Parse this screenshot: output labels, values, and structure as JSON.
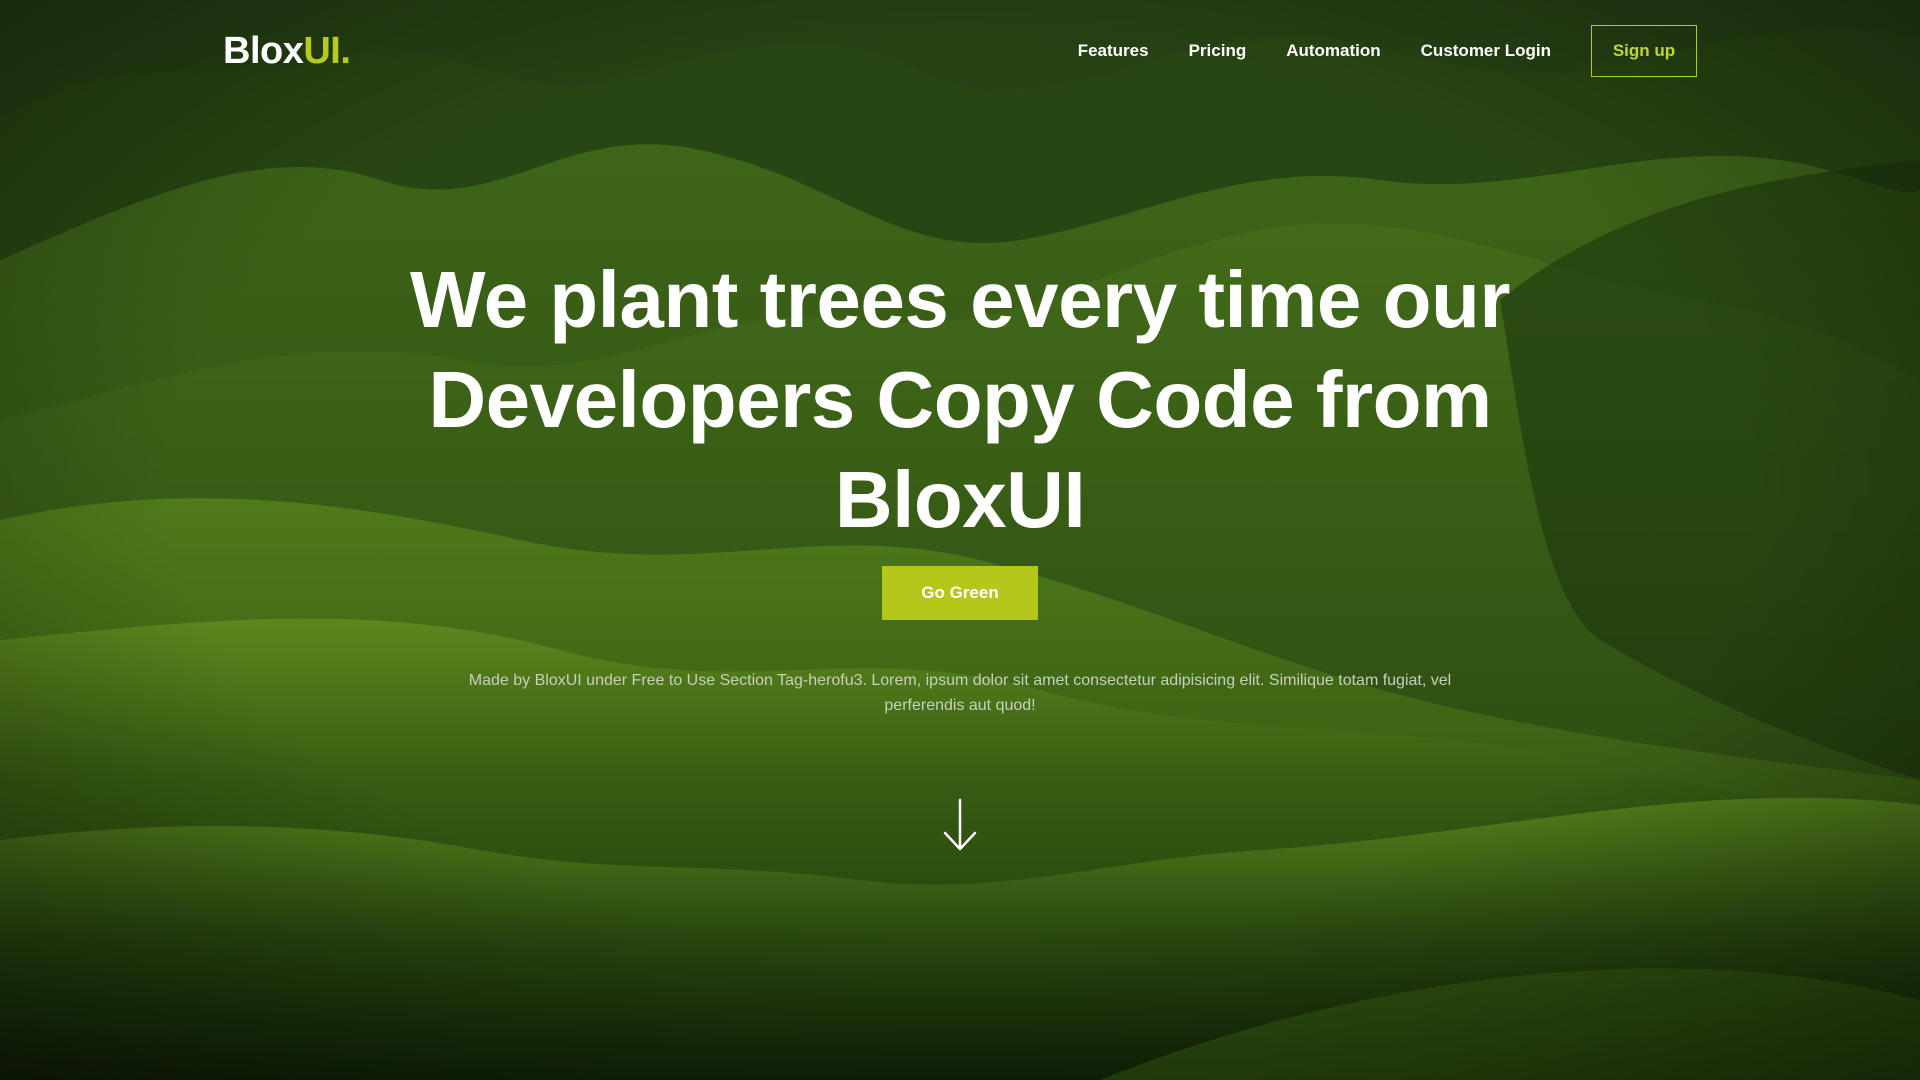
{
  "brand": {
    "name_main": "Blox",
    "name_accent": "UI",
    "name_dot": ".",
    "accent_color": "#b7cb1c"
  },
  "nav": {
    "items": [
      {
        "label": "Features"
      },
      {
        "label": "Pricing"
      },
      {
        "label": "Automation"
      },
      {
        "label": "Customer Login"
      }
    ],
    "signup_label": "Sign up"
  },
  "hero": {
    "headline": "We plant trees every time our Developers Copy Code from BloxUI",
    "cta_label": "Go Green",
    "subtext": "Made by BloxUI under Free to Use Section Tag-herofu3. Lorem, ipsum dolor sit amet consectetur adipisicing elit. Similique totam fugiat, vel perferendis aut quod!",
    "scroll_icon": "arrow-down-icon"
  },
  "colors": {
    "cta_background": "#b4c71a",
    "text": "#ffffff",
    "subtext": "#c9cfbd"
  }
}
